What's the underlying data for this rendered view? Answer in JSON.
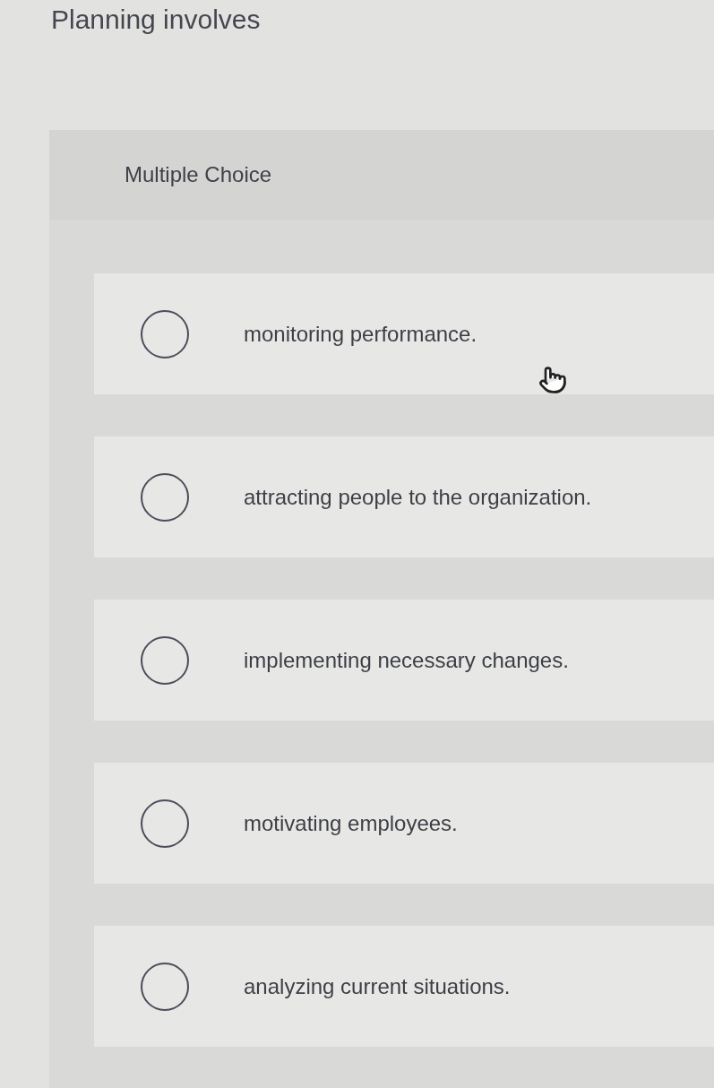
{
  "question": {
    "title": "Planning involves"
  },
  "panel": {
    "heading": "Multiple Choice"
  },
  "options": [
    {
      "label": "monitoring performance.",
      "selected": false
    },
    {
      "label": "attracting people to the organization.",
      "selected": false
    },
    {
      "label": "implementing necessary changes.",
      "selected": false
    },
    {
      "label": "motivating employees.",
      "selected": false
    },
    {
      "label": "analyzing current situations.",
      "selected": false
    }
  ]
}
